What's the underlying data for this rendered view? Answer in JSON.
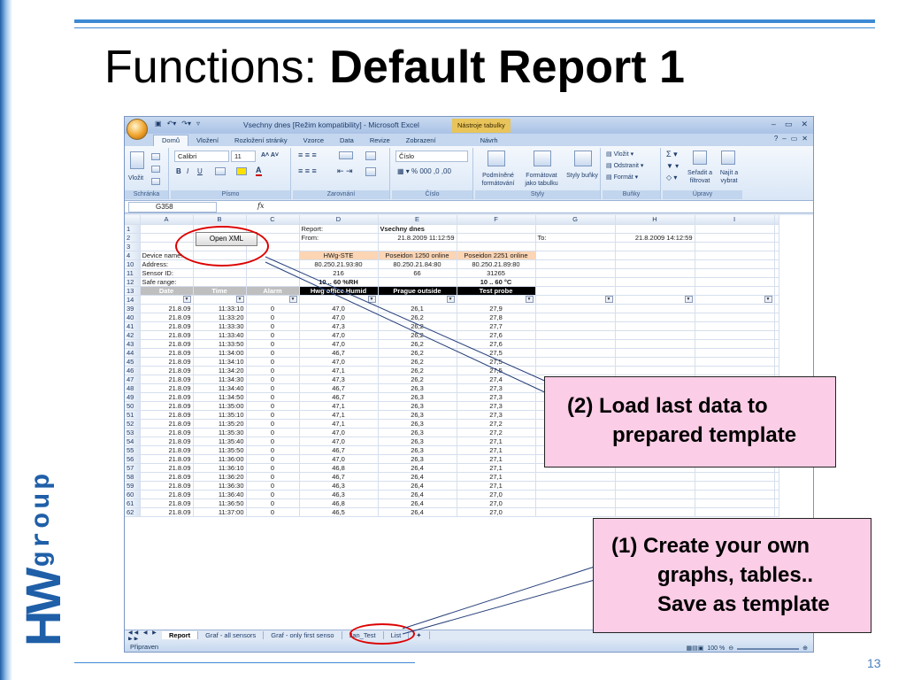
{
  "slide": {
    "title_regular": "Functions: ",
    "title_bold": "Default Report 1",
    "page_number": "13",
    "logo_text": "HW",
    "logo_sub": "group",
    "colors": {
      "accent": "#3d8ad4",
      "logo": "#1f5fa8",
      "callout_bg": "#fbcde6",
      "highlight": "#dd0000"
    }
  },
  "excel": {
    "window_title": "Vsechny dnes  [Režim kompatibility] - Microsoft Excel",
    "context_tab": "Nástroje tabulky",
    "ribbon_tabs": [
      "Domů",
      "Vložení",
      "Rozložení stránky",
      "Vzorce",
      "Data",
      "Revize",
      "Zobrazení",
      "Návrh"
    ],
    "groups": {
      "clipboard": {
        "label": "Schránka",
        "paste": "Vložit"
      },
      "font": {
        "label": "Písmo",
        "font_name": "Calibri",
        "font_size": "11"
      },
      "alignment": {
        "label": "Zarovnání"
      },
      "number": {
        "label": "Číslo",
        "format": "Číslo"
      },
      "styles": {
        "label": "Styly",
        "conditional": "Podmíněné formátování",
        "format_table": "Formátovat jako tabulku",
        "cell_styles": "Styly buňky"
      },
      "cells": {
        "label": "Buňky",
        "insert": "Vložit",
        "delete": "Odstranit",
        "format": "Formát"
      },
      "editing": {
        "label": "Úpravy",
        "sort": "Seřadit a filtrovat",
        "find": "Najít a vybrat"
      }
    },
    "name_box": "G358",
    "fx": "fx",
    "columns": [
      "A",
      "B",
      "C",
      "D",
      "E",
      "F",
      "G",
      "H",
      "I"
    ],
    "open_xml_button": "Open XML",
    "header_rows": [
      {
        "row": "1",
        "cells": [
          "",
          "",
          "",
          "Report:",
          "Vsechny dnes",
          "",
          "",
          "",
          ""
        ]
      },
      {
        "row": "2",
        "cells": [
          "",
          "",
          "",
          "From:",
          "21.8.2009 11:12:59",
          "",
          "To:",
          "21.8.2009 14:12:59",
          ""
        ]
      },
      {
        "row": "3",
        "cells": [
          "",
          "",
          "",
          "",
          "",
          "",
          "",
          "",
          ""
        ]
      },
      {
        "row": "4",
        "cells": [
          "Device name:",
          "",
          "",
          "HWg-STE",
          "Poseidon 1250 online",
          "Poseidon 2251 online",
          "",
          "",
          ""
        ]
      },
      {
        "row": "10",
        "cells": [
          "Address:",
          "",
          "",
          "80.250.21.93:80",
          "80.250.21.84:80",
          "80.250.21.89:80",
          "",
          "",
          ""
        ]
      },
      {
        "row": "11",
        "cells": [
          "Sensor ID:",
          "",
          "",
          "216",
          "66",
          "31265",
          "",
          "",
          ""
        ]
      },
      {
        "row": "12",
        "cells": [
          "Safe range:",
          "",
          "",
          "10 .. 60 %RH",
          "",
          "10 .. 60 °C",
          "",
          "",
          ""
        ]
      },
      {
        "row": "13",
        "cells": [
          "Date",
          "Time",
          "Alarm",
          "Hwg office Humid",
          "Prague outside",
          "Test probe",
          "",
          "",
          ""
        ]
      }
    ],
    "filter_row": "14",
    "data_rows": [
      [
        "39",
        "21.8.09",
        "11:33:10",
        "0",
        "47,0",
        "26,1",
        "27,9"
      ],
      [
        "40",
        "21.8.09",
        "11:33:20",
        "0",
        "47,0",
        "26,2",
        "27,8"
      ],
      [
        "41",
        "21.8.09",
        "11:33:30",
        "0",
        "47,3",
        "26,2",
        "27,7"
      ],
      [
        "42",
        "21.8.09",
        "11:33:40",
        "0",
        "47,0",
        "26,2",
        "27,6"
      ],
      [
        "43",
        "21.8.09",
        "11:33:50",
        "0",
        "47,0",
        "26,2",
        "27,6"
      ],
      [
        "44",
        "21.8.09",
        "11:34:00",
        "0",
        "46,7",
        "26,2",
        "27,5"
      ],
      [
        "45",
        "21.8.09",
        "11:34:10",
        "0",
        "47,0",
        "26,2",
        "27,5"
      ],
      [
        "46",
        "21.8.09",
        "11:34:20",
        "0",
        "47,1",
        "26,2",
        "27,5"
      ],
      [
        "47",
        "21.8.09",
        "11:34:30",
        "0",
        "47,3",
        "26,2",
        "27,4"
      ],
      [
        "48",
        "21.8.09",
        "11:34:40",
        "0",
        "46,7",
        "26,3",
        "27,3"
      ],
      [
        "49",
        "21.8.09",
        "11:34:50",
        "0",
        "46,7",
        "26,3",
        "27,3"
      ],
      [
        "50",
        "21.8.09",
        "11:35:00",
        "0",
        "47,1",
        "26,3",
        "27,3"
      ],
      [
        "51",
        "21.8.09",
        "11:35:10",
        "0",
        "47,1",
        "26,3",
        "27,3"
      ],
      [
        "52",
        "21.8.09",
        "11:35:20",
        "0",
        "47,1",
        "26,3",
        "27,2"
      ],
      [
        "53",
        "21.8.09",
        "11:35:30",
        "0",
        "47,0",
        "26,3",
        "27,2"
      ],
      [
        "54",
        "21.8.09",
        "11:35:40",
        "0",
        "47,0",
        "26,3",
        "27,1"
      ],
      [
        "55",
        "21.8.09",
        "11:35:50",
        "0",
        "46,7",
        "26,3",
        "27,1"
      ],
      [
        "56",
        "21.8.09",
        "11:36:00",
        "0",
        "47,0",
        "26,3",
        "27,1"
      ],
      [
        "57",
        "21.8.09",
        "11:36:10",
        "0",
        "46,8",
        "26,4",
        "27,1"
      ],
      [
        "58",
        "21.8.09",
        "11:36:20",
        "0",
        "46,7",
        "26,4",
        "27,1"
      ],
      [
        "59",
        "21.8.09",
        "11:36:30",
        "0",
        "46,3",
        "26,4",
        "27,1"
      ],
      [
        "60",
        "21.8.09",
        "11:36:40",
        "0",
        "46,3",
        "26,4",
        "27,0"
      ],
      [
        "61",
        "21.8.09",
        "11:36:50",
        "0",
        "46,8",
        "26,4",
        "27,0"
      ],
      [
        "62",
        "21.8.09",
        "11:37:00",
        "0",
        "46,5",
        "26,4",
        "27,0"
      ]
    ],
    "sheet_tabs": [
      "Report",
      "Graf - all sensors",
      "Graf - only first senso",
      "Jan_Test",
      "List"
    ],
    "status": "Připraven",
    "zoom": "100 %"
  },
  "callouts": {
    "c2_line1": "(2)  Load last data to",
    "c2_line2": "prepared template",
    "c1_line1": "(1)  Create your own",
    "c1_line2": "graphs, tables..",
    "c1_line3": "Save as template"
  }
}
